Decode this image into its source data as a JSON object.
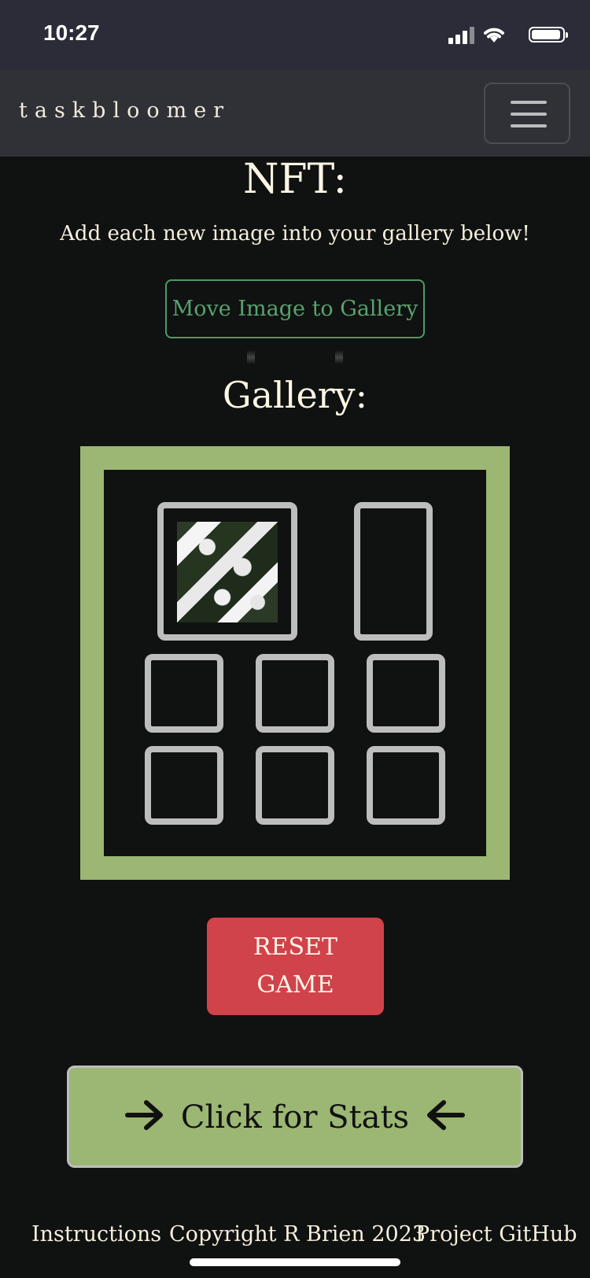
{
  "status": {
    "time": "10:27"
  },
  "navbar": {
    "brand": "taskbloomer",
    "menu_icon": "hamburger-icon"
  },
  "nft": {
    "title": "NFT:",
    "subtitle": "Add each new image into your gallery below!",
    "move_button": "Move Image to Gallery"
  },
  "gallery": {
    "title": "Gallery:",
    "slots_filled": 1,
    "slots_total": 8
  },
  "actions": {
    "reset_line1": "RESET",
    "reset_line2": "GAME",
    "stats_label": "Click for Stats"
  },
  "footer": {
    "instructions": "Instructions",
    "copyright": "Copyright R Brien 2023",
    "github": "Project GitHub"
  },
  "colors": {
    "frame": "#9cb673",
    "accent_green": "#58a36f",
    "reset_red": "#d0434b",
    "background": "#101111"
  }
}
